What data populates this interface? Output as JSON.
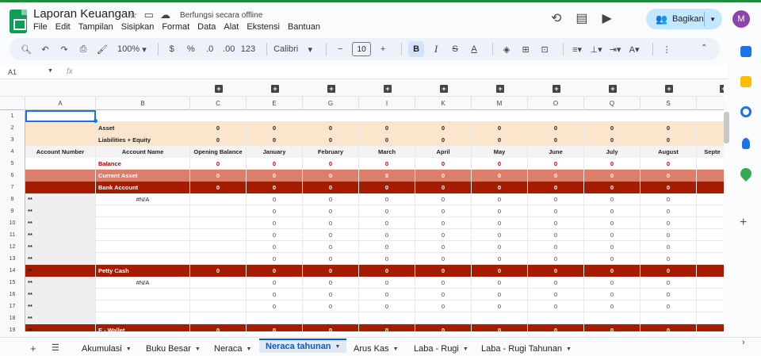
{
  "app": {
    "doc_title": "Laporan Keuangan",
    "offline_status": "Berfungsi secara offline",
    "menu": [
      "File",
      "Edit",
      "Tampilan",
      "Sisipkan",
      "Format",
      "Data",
      "Alat",
      "Ekstensi",
      "Bantuan"
    ],
    "share_label": "Bagikan",
    "avatar_letter": "M"
  },
  "toolbar": {
    "zoom": "100%",
    "currency": "$",
    "percent": "%",
    "dec_decrease": ".0",
    "dec_increase": ".00",
    "num_format": "123",
    "font": "Calibri",
    "font_size": "10",
    "minus": "−",
    "plus": "+"
  },
  "formula_bar": {
    "cell_ref": "A1",
    "fx": "fx"
  },
  "grid": {
    "columns": [
      "A",
      "B",
      "C",
      "E",
      "G",
      "I",
      "K",
      "M",
      "O",
      "Q",
      "S",
      ""
    ],
    "row_numbers": [
      "1",
      "2",
      "3",
      "4",
      "5",
      "6",
      "7",
      "8",
      "9",
      "10",
      "11",
      "12",
      "13",
      "14",
      "15",
      "16",
      "17",
      "18",
      "19"
    ],
    "header_row": [
      "Account Number",
      "Account Name",
      "Opening Balance",
      "January",
      "February",
      "March",
      "April",
      "May",
      "June",
      "July",
      "August",
      "Septe"
    ],
    "labels": {
      "asset": "Asset",
      "liab": "Liabilities + Equity",
      "balance": "Balance",
      "current_asset": "Current Asset",
      "bank_account": "Bank Account",
      "petty_cash": "Petty Cash",
      "ewallet": "E - Wallet",
      "na": "#N/A",
      "stars": "**",
      "zero": "0"
    }
  },
  "sheets": [
    "Akumulasi",
    "Buku Besar",
    "Neraca",
    "Neraca tahunan",
    "Arus Kas",
    "Laba - Rugi",
    "Laba - Rugi Tahunan"
  ],
  "active_sheet": "Neraca tahunan",
  "colors": {
    "asset_fill": "#fce5cd",
    "current_asset_fill": "#dd7e6b",
    "dark_red": "#a61c00",
    "balance_text": "#c00000",
    "accent": "#1a73e8"
  }
}
